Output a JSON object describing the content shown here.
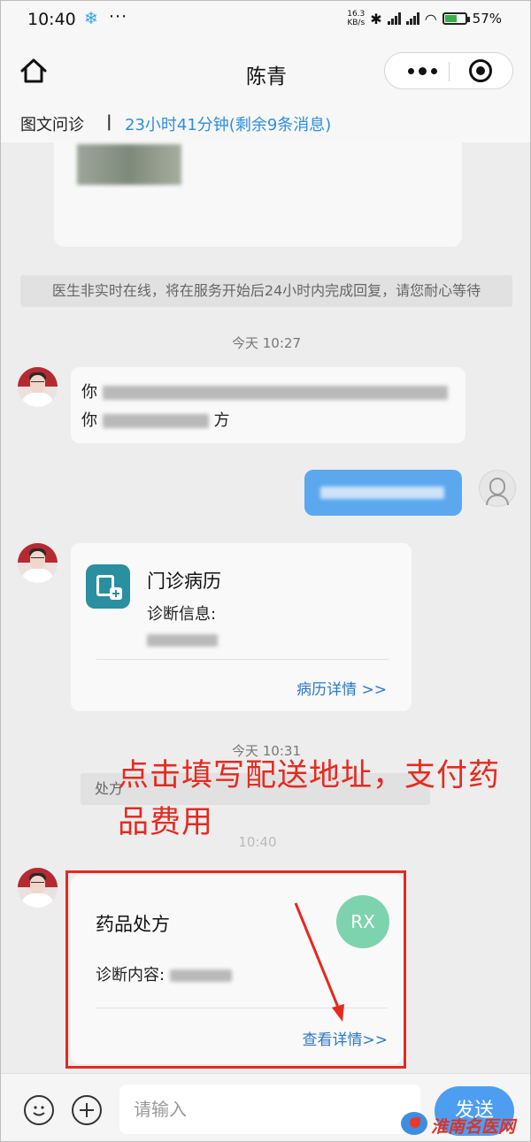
{
  "status_bar": {
    "time": "10:40",
    "speed_value": "16.3",
    "speed_unit": "KB/s",
    "battery": "57%"
  },
  "nav": {
    "title": "陈青"
  },
  "consult_info": {
    "type": "图文问诊",
    "separator": "|",
    "remaining": "23小时41分钟(剩余9条消息)"
  },
  "chat": {
    "system_notice": "医生非实时在线，将在服务开始后24小时内完成回复，请您耐心等待",
    "time_1": "今天 10:27",
    "doctor_msg_prefix_1": "你",
    "doctor_msg_prefix_2": "你",
    "doctor_msg_suffix_2": "方",
    "medical_record": {
      "title": "门诊病历",
      "subtitle": "诊断信息:",
      "link": "病历详情 >>"
    },
    "time_2": "今天 10:31",
    "hidden_notice_start": "处方",
    "prescription": {
      "title": "药品处方",
      "badge": "RX",
      "diagnosis_label": "诊断内容:",
      "link": "查看详情>>"
    }
  },
  "annotation": {
    "text": "点击填写配送地址，支付药品费用"
  },
  "input_bar": {
    "placeholder": "请输入",
    "send": "发送"
  },
  "watermark": {
    "text": "淮南名医网"
  },
  "colors": {
    "accent": "#2f8ede",
    "send_button": "#4d9ef0",
    "annotation_red": "#e52a20",
    "rx_badge": "#7dd3ad"
  }
}
